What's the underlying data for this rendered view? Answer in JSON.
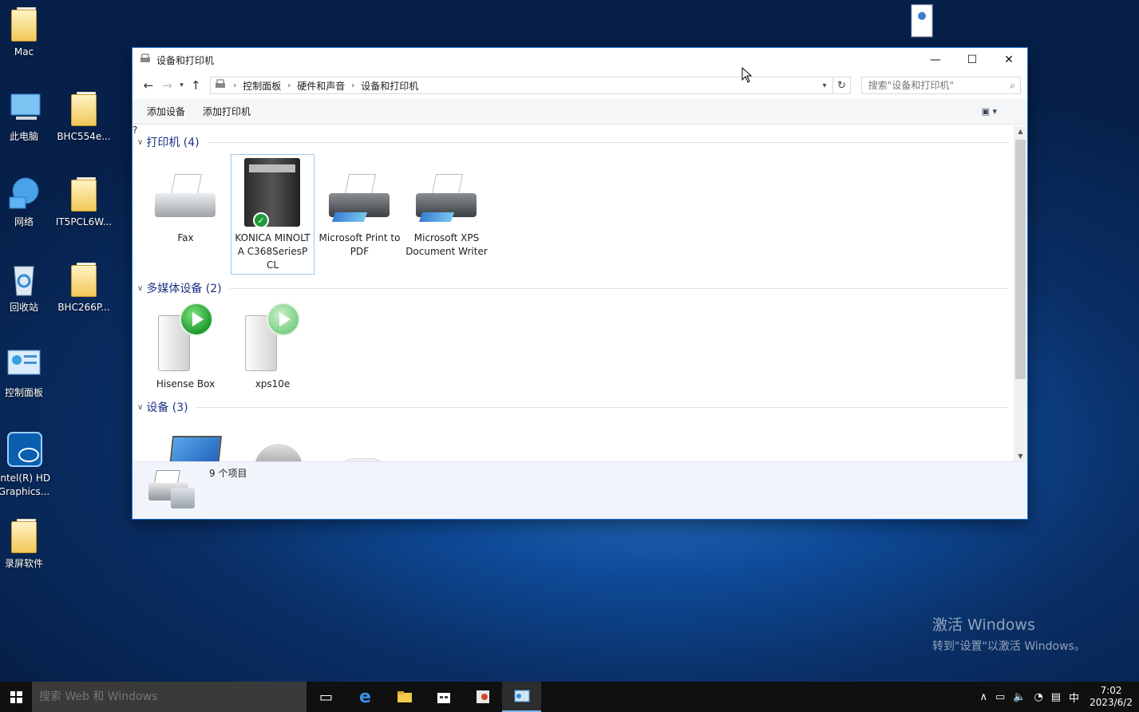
{
  "desktop": {
    "icons": [
      {
        "label": "Mac"
      },
      {
        "label": "此电脑"
      },
      {
        "label": "BHC554e..."
      },
      {
        "label": "网络"
      },
      {
        "label": "IT5PCL6W..."
      },
      {
        "label": "回收站"
      },
      {
        "label": "BHC266P..."
      },
      {
        "label": "控制面板"
      },
      {
        "label": "Intel(R) HD Graphics..."
      },
      {
        "label": "录屏软件"
      }
    ],
    "watermark": {
      "line1": "激活 Windows",
      "line2": "转到\"设置\"以激活 Windows。"
    }
  },
  "window": {
    "title": "设备和打印机",
    "controls": {
      "minimize": "—",
      "maximize": "☐",
      "close": "✕"
    },
    "breadcrumb": [
      "控制面板",
      "硬件和声音",
      "设备和打印机"
    ],
    "search_placeholder": "搜索\"设备和打印机\"",
    "commands": {
      "add_device": "添加设备",
      "add_printer": "添加打印机"
    },
    "help": "?",
    "groups": [
      {
        "header": "打印机 (4)",
        "items": [
          "Fax",
          "KONICA MINOLTA C368SeriesPCL",
          "Microsoft Print to PDF",
          "Microsoft XPS Document Writer"
        ]
      },
      {
        "header": "多媒体设备 (2)",
        "items": [
          "Hisense Box",
          "xps10e"
        ]
      },
      {
        "header": "设备 (3)",
        "items": []
      }
    ],
    "status": {
      "count": "9 个项目"
    }
  },
  "taskbar": {
    "search_placeholder": "搜索 Web 和 Windows",
    "ime": "中",
    "time": "7:02",
    "date": "2023/6/2"
  }
}
